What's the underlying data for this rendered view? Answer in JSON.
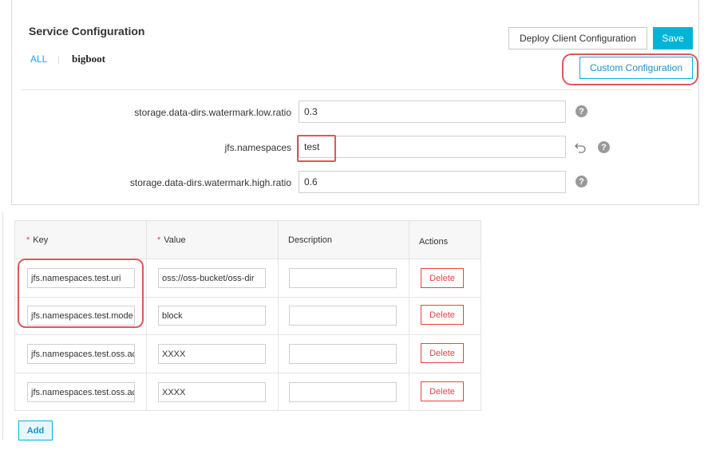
{
  "panel": {
    "title": "Service Configuration",
    "tabs": [
      "ALL",
      "bigboot"
    ],
    "buttons": {
      "deploy": "Deploy Client Configuration",
      "save": "Save",
      "custom": "Custom Configuration"
    },
    "config_rows": [
      {
        "key": "storage.data-dirs.watermark.low.ratio",
        "value": "0.3"
      },
      {
        "key": "jfs.namespaces",
        "value": "test"
      },
      {
        "key": "storage.data-dirs.watermark.high.ratio",
        "value": "0.6"
      }
    ],
    "help_glyph": "?"
  },
  "table": {
    "headers": {
      "key": "Key",
      "value": "Value",
      "description": "Description",
      "actions": "Actions"
    },
    "required_mark": "*",
    "rows": [
      {
        "key": "jfs.namespaces.test.uri",
        "value": "oss://oss-bucket/oss-dir",
        "description": "",
        "action": "Delete"
      },
      {
        "key": "jfs.namespaces.test.mode",
        "value": "block",
        "description": "",
        "action": "Delete"
      },
      {
        "key": "jfs.namespaces.test.oss.acc",
        "value": "XXXX",
        "description": "",
        "action": "Delete"
      },
      {
        "key": "jfs.namespaces.test.oss.acc",
        "value": "XXXX",
        "description": "",
        "action": "Delete"
      }
    ],
    "add_label": "Add"
  },
  "colors": {
    "accent": "#00b4d8",
    "danger": "#e64545",
    "highlight": "#e0575a"
  }
}
